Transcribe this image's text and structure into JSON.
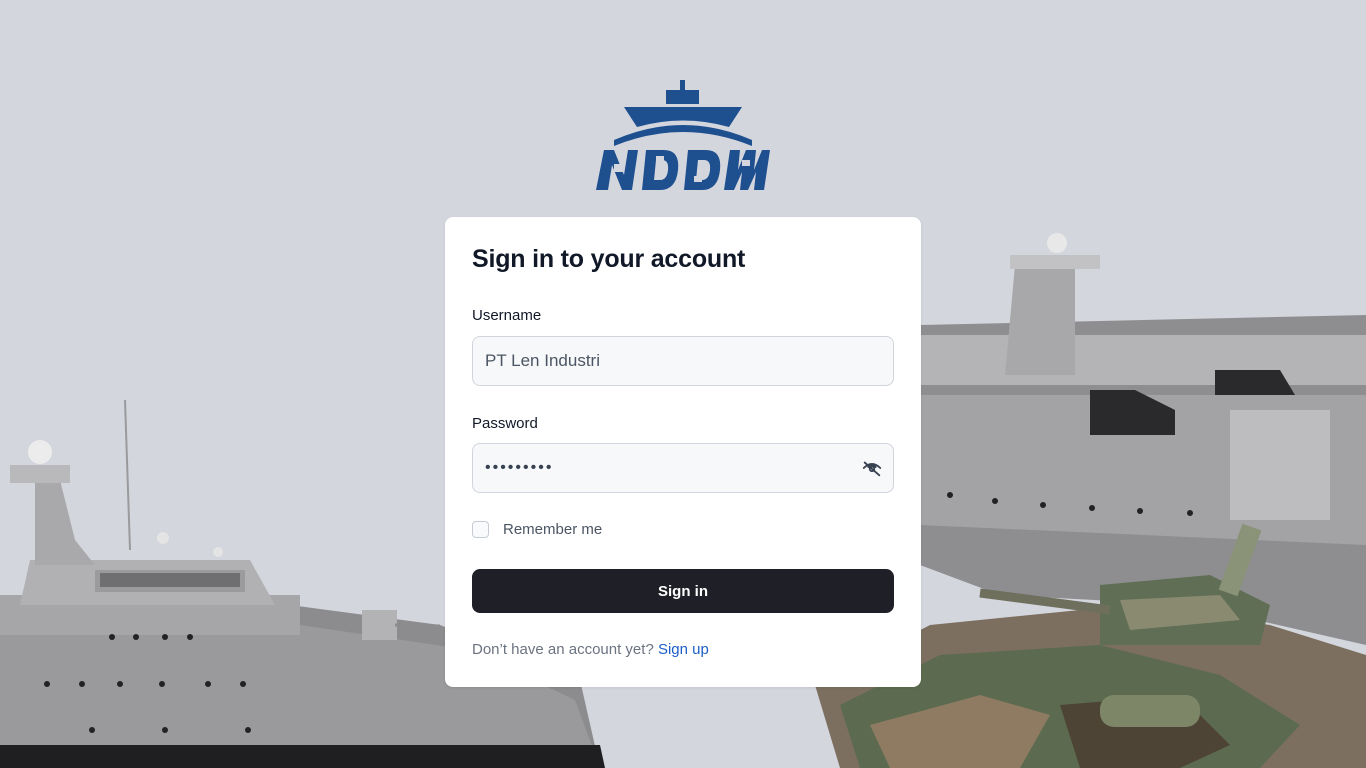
{
  "brand": {
    "logo_text": "NDDM",
    "logo_color": "#1e4f8f"
  },
  "login": {
    "title": "Sign in to your account",
    "username_label": "Username",
    "username_value": "PT Len Industri",
    "password_label": "Password",
    "password_masked": "•••••••••",
    "password_toggle_icon": "eye-slash-icon",
    "remember_label": "Remember me",
    "remember_checked": false,
    "submit_label": "Sign in",
    "signup_prompt": "Don’t have an account yet?",
    "signup_link": "Sign up"
  },
  "colors": {
    "background": "#d4d6de",
    "primary_button": "#1f1f27",
    "link": "#1d5ec7"
  }
}
